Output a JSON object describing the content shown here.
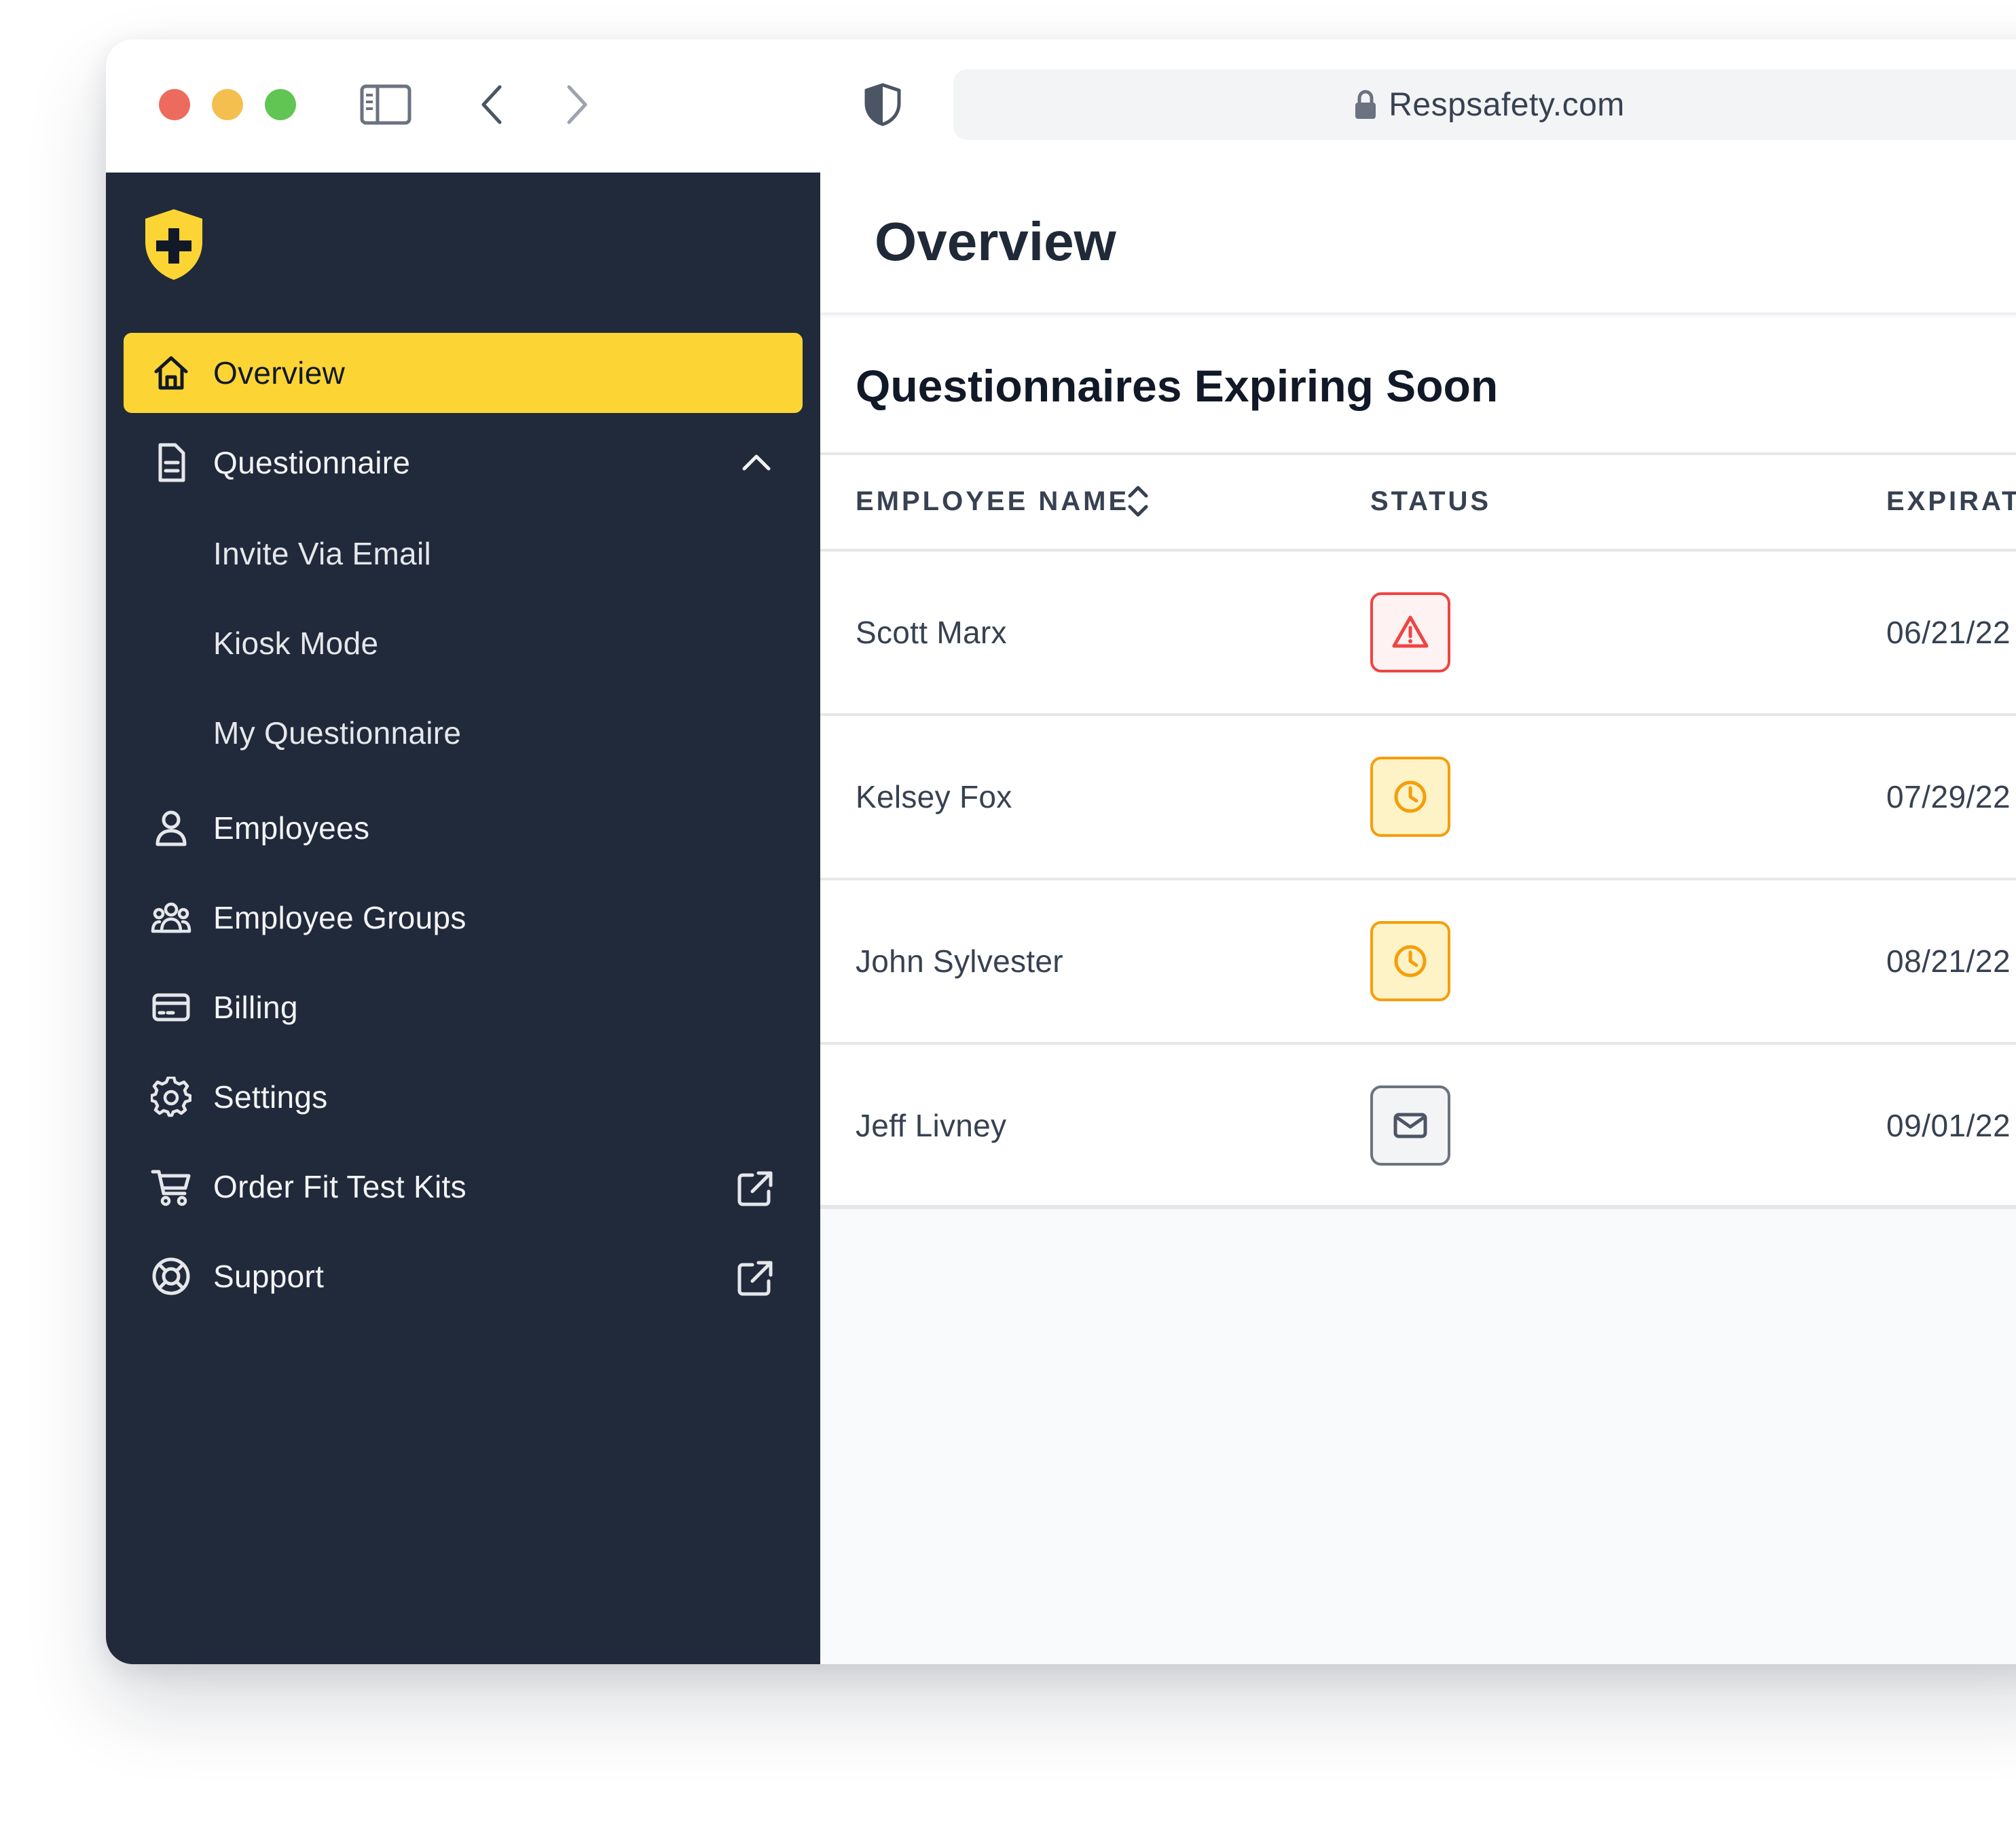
{
  "browser": {
    "url": "Respsafety.com"
  },
  "sidebar": {
    "items": [
      {
        "label": "Overview",
        "icon": "home-icon",
        "active": true
      },
      {
        "label": "Questionnaire",
        "icon": "document-icon",
        "expanded": true,
        "children": [
          {
            "label": "Invite Via Email"
          },
          {
            "label": "Kiosk Mode"
          },
          {
            "label": "My Questionnaire"
          }
        ]
      },
      {
        "label": "Employees",
        "icon": "user-icon"
      },
      {
        "label": "Employee Groups",
        "icon": "user-group-icon"
      },
      {
        "label": "Billing",
        "icon": "credit-card-icon"
      },
      {
        "label": "Settings",
        "icon": "gear-icon"
      },
      {
        "label": "Order Fit Test Kits",
        "icon": "shopping-cart-icon",
        "external": true
      },
      {
        "label": "Support",
        "icon": "life-ring-icon",
        "external": true
      }
    ]
  },
  "main": {
    "title": "Overview",
    "section_title": "Questionnaires Expiring Soon",
    "table": {
      "columns": [
        "EMPLOYEE NAME",
        "STATUS",
        "EXPIRAT"
      ],
      "rows": [
        {
          "name": "Scott Marx",
          "status": "warning",
          "status_icon": "warning-triangle-icon",
          "expiration": "06/21/22"
        },
        {
          "name": "Kelsey Fox",
          "status": "pending",
          "status_icon": "clock-icon",
          "expiration": "07/29/22"
        },
        {
          "name": "John Sylvester",
          "status": "pending",
          "status_icon": "clock-icon",
          "expiration": "08/21/22"
        },
        {
          "name": "Jeff Livney",
          "status": "invited",
          "status_icon": "envelope-icon",
          "expiration": "09/01/22"
        }
      ]
    }
  },
  "colors": {
    "sidebar_bg": "#212a3b",
    "accent_yellow": "#fcd535",
    "danger": "#ef4444",
    "warning": "#f59e0b",
    "neutral": "#6b7280"
  }
}
